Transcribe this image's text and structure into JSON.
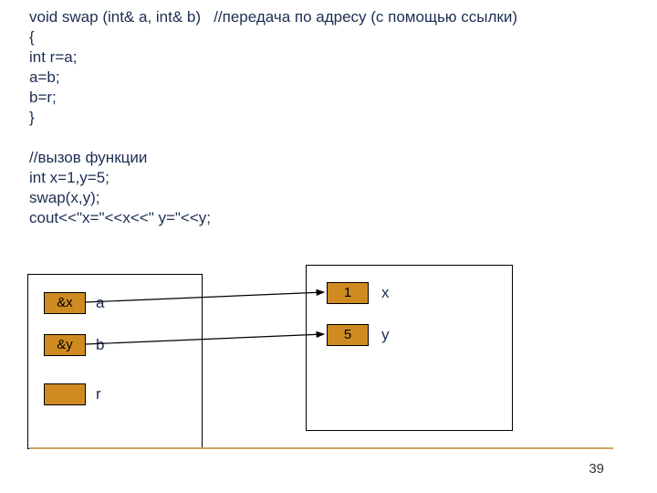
{
  "code": {
    "line1": "void swap (int& a, int& b)   //передача по адресу (с помощью ссылки)",
    "line2": "{",
    "line3": "int r=a;",
    "line4": "a=b;",
    "line5": "b=r;",
    "line6": "}",
    "line7": "",
    "line8": "//вызов функции",
    "line9": "int x=1,y=5;",
    "line10": "swap(x,y);",
    "line11": "cout<<\"x=\"<<x<<\" y=\"<<y;"
  },
  "left": {
    "a_val": "&x",
    "a_lbl": "a",
    "b_val": "&y",
    "b_lbl": "b",
    "r_val": "",
    "r_lbl": "r"
  },
  "right": {
    "x_val": "1",
    "x_lbl": "x",
    "y_val": "5",
    "y_lbl": "y"
  },
  "page": "39"
}
